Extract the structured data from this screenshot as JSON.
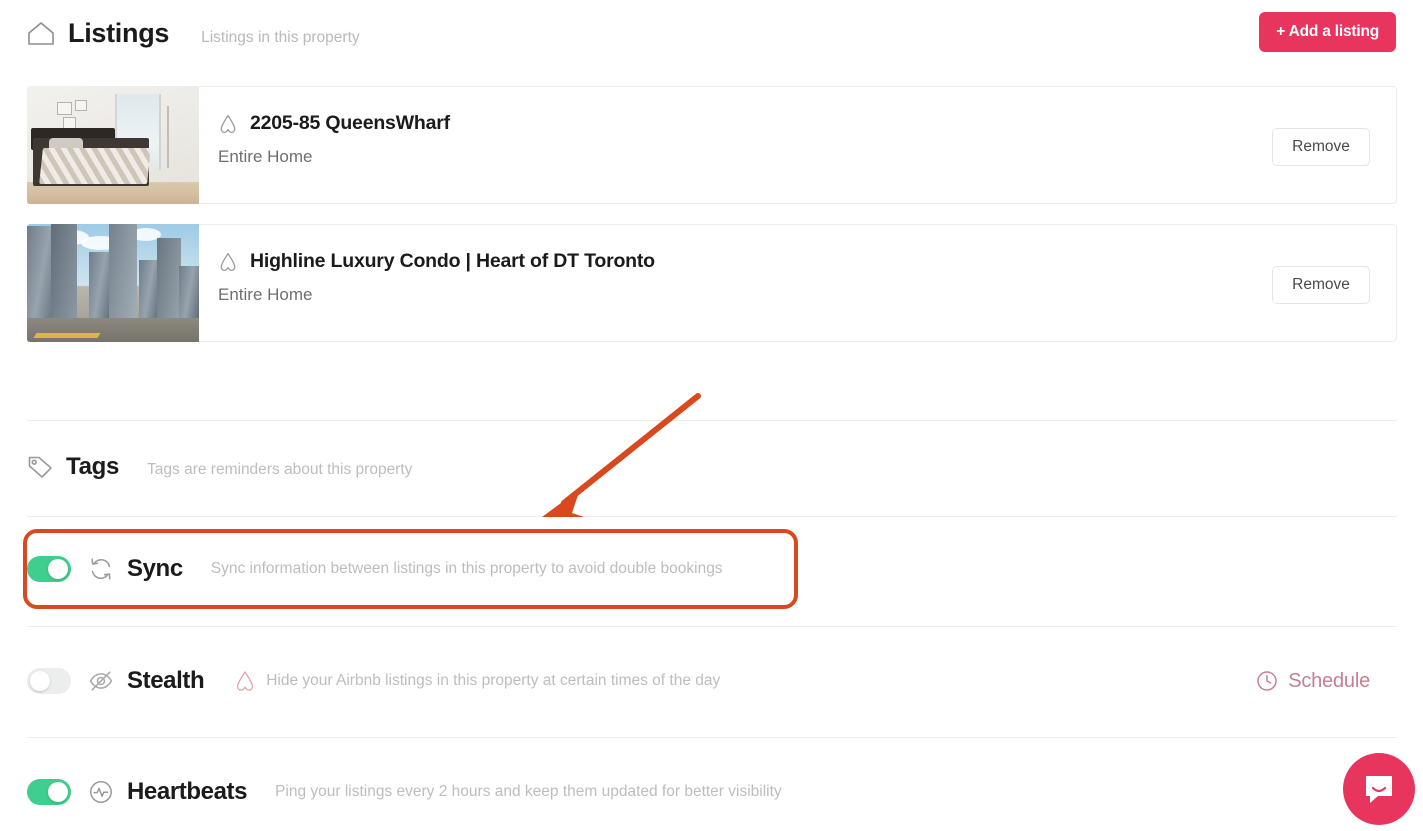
{
  "header": {
    "home_icon": "home-icon",
    "title": "Listings",
    "subtitle": "Listings in this property",
    "add_button_label": "+ Add a listing"
  },
  "listings": [
    {
      "platform_icon": "airbnb-icon",
      "thumbnail": "bedroom-photo",
      "title": "2205-85 QueensWharf",
      "subtitle": "Entire Home",
      "remove_label": "Remove"
    },
    {
      "platform_icon": "airbnb-icon",
      "thumbnail": "city-skyline-photo",
      "title": "Highline Luxury Condo | Heart of DT Toronto",
      "subtitle": "Entire Home",
      "remove_label": "Remove"
    }
  ],
  "tags": {
    "icon": "tag-icon",
    "title": "Tags",
    "description": "Tags are reminders about this property"
  },
  "features": [
    {
      "key": "sync",
      "toggle_state": "on",
      "icon": "sync-icon",
      "name": "Sync",
      "description": "Sync information between listings in this property to avoid double bookings"
    },
    {
      "key": "stealth",
      "toggle_state": "off",
      "icon": "eye-off-icon",
      "name": "Stealth",
      "desc_icon": "airbnb-icon",
      "description": "Hide your Airbnb listings in this property at certain times of the day",
      "action_icon": "clock-icon",
      "action_label": "Schedule"
    },
    {
      "key": "heartbeats",
      "toggle_state": "on",
      "icon": "pulse-icon",
      "name": "Heartbeats",
      "description": "Ping your listings every 2 hours and keep them updated for better visibility"
    }
  ],
  "annotations": {
    "arrow": "red-arrow-pointing-to-sync-row",
    "highlight_box": "red-rounded-rectangle-around-sync-row",
    "color": "#d9491f"
  },
  "chat_widget": {
    "icon": "intercom-chat-icon",
    "color": "#e8355e"
  },
  "colors": {
    "accent_pink": "#e8355e",
    "toggle_on_green": "#3fce8e",
    "toggle_off_gray": "#eceded",
    "annotation_orange": "#d9491f",
    "schedule_rose": "#c77f90",
    "muted_text": "#bdbdbd"
  }
}
